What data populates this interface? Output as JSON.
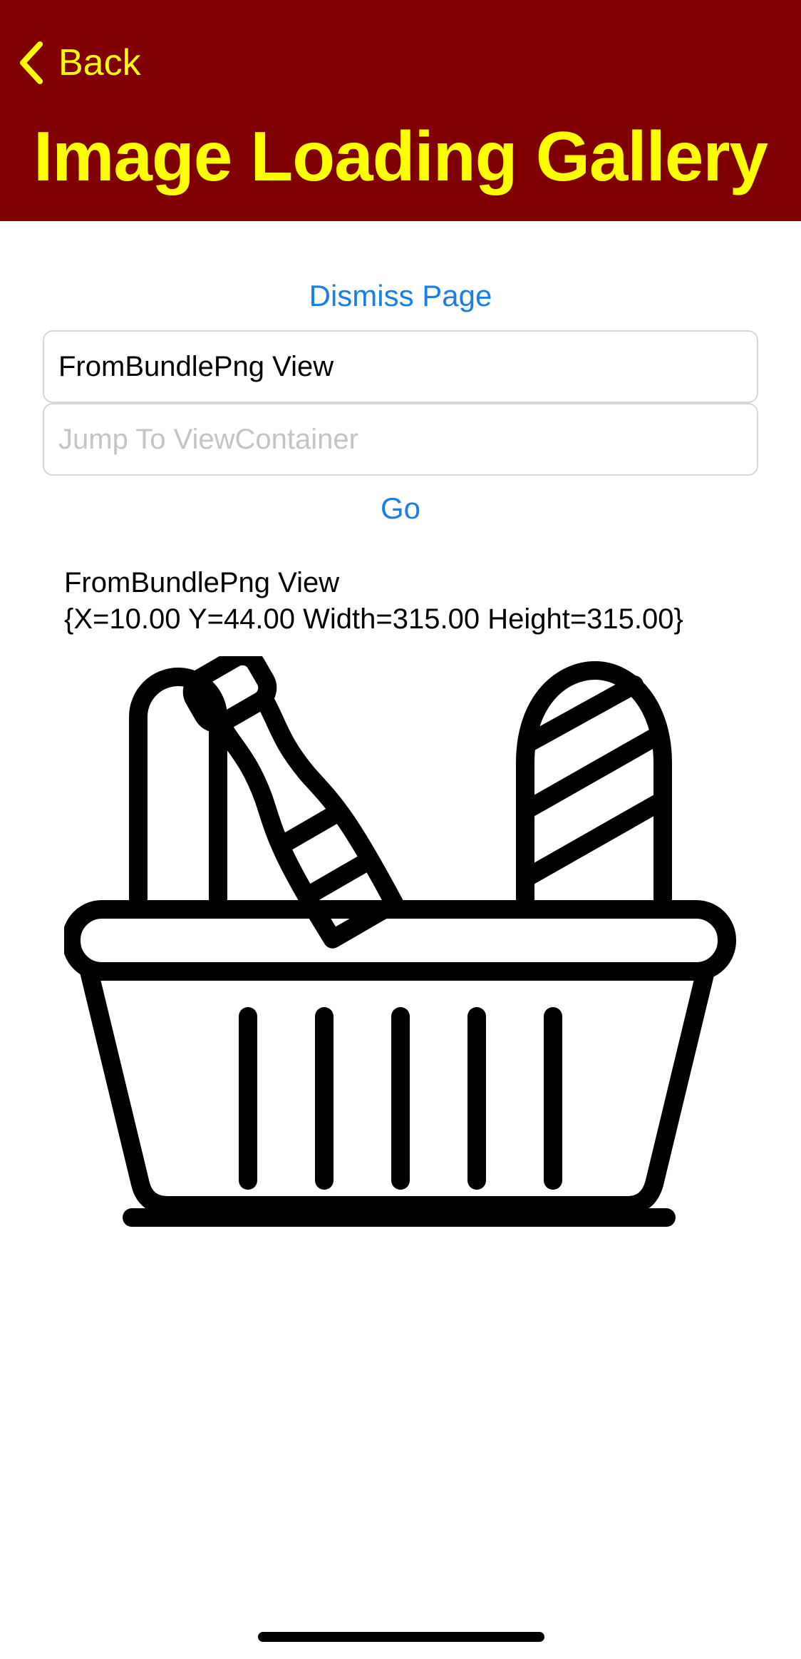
{
  "nav": {
    "back_label": "Back",
    "title": "Image Loading Gallery",
    "background_color": "#800000",
    "foreground_color": "#ffff00",
    "back_icon": "chevron-left-icon"
  },
  "main": {
    "dismiss_label": "Dismiss Page",
    "selected_view_value": "FromBundlePng View",
    "jump_placeholder": "Jump To ViewContainer",
    "jump_value": "",
    "go_label": "Go",
    "info_line_1": "FromBundlePng View",
    "info_line_2": "{X=10.00 Y=44.00 Width=315.00 Height=315.00}",
    "image_icon": "grocery-basket-icon",
    "link_color": "#1a7fe5"
  }
}
